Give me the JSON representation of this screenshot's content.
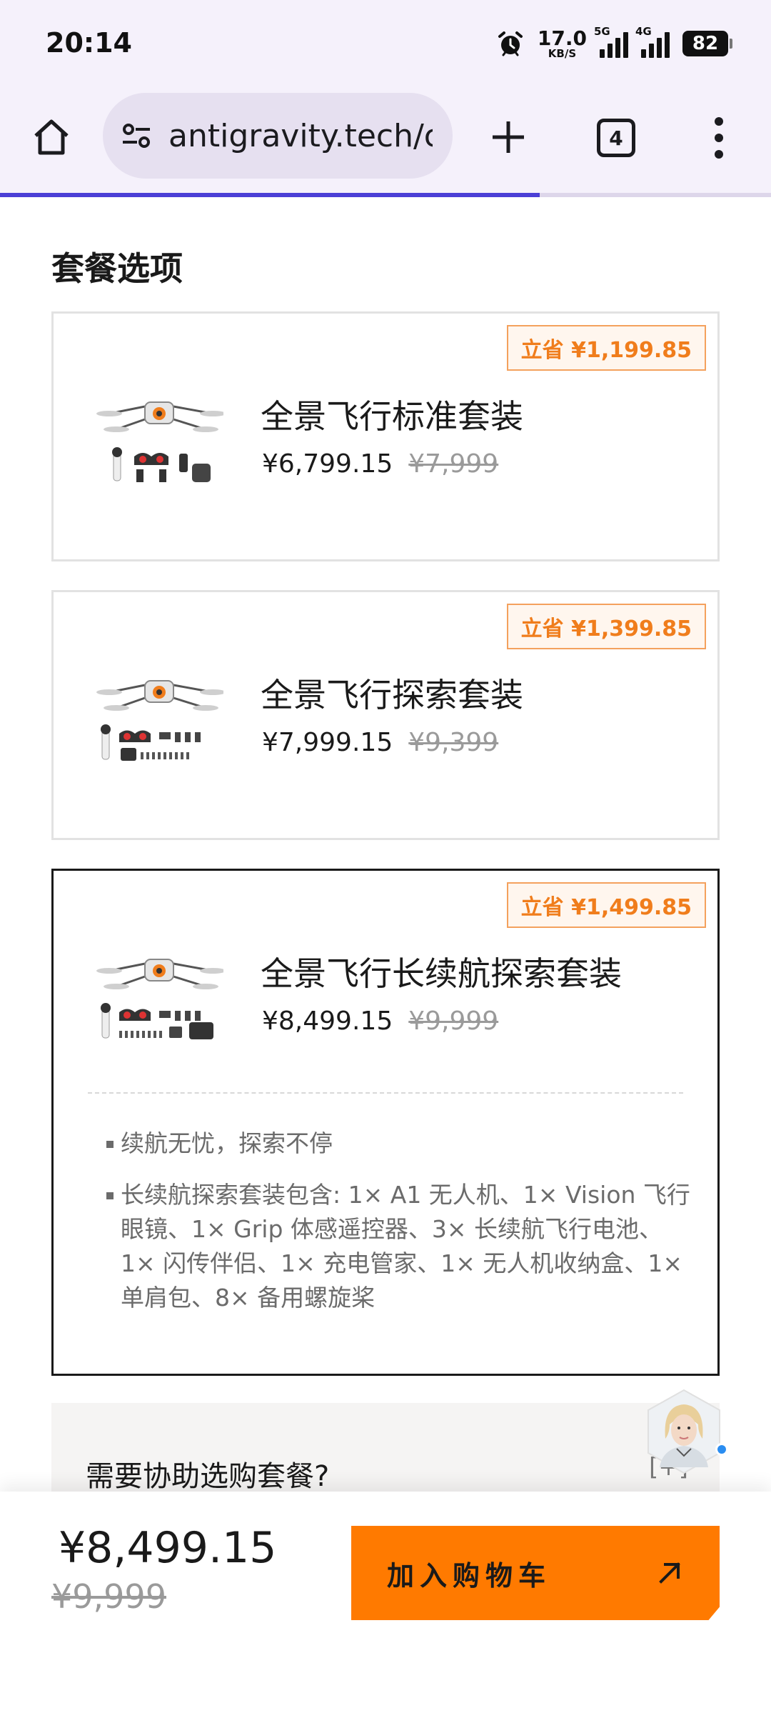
{
  "status_bar": {
    "time": "20:14",
    "net_speed": "17.0",
    "net_unit": "KB/S",
    "sim1_tag": "5G",
    "sim2_tag": "4G",
    "battery": "82",
    "icons": [
      "alarm-icon",
      "signal-icon",
      "battery-icon"
    ]
  },
  "browser": {
    "url": "antigravity.tech/c",
    "tab_count": "4",
    "page_load_progress": 0.7,
    "icons": [
      "home-icon",
      "site-settings-icon",
      "plus-icon",
      "tabs-icon",
      "more-vert-icon"
    ]
  },
  "page": {
    "section_title": "套餐选项",
    "packages": [
      {
        "name": "全景飞行标准套装",
        "price": "¥6,799.15",
        "original_price": "¥7,999",
        "save_label": "立省 ¥1,199.85",
        "selected": false
      },
      {
        "name": "全景飞行探索套装",
        "price": "¥7,999.15",
        "original_price": "¥9,399",
        "save_label": "立省 ¥1,399.85",
        "selected": false
      },
      {
        "name": "全景飞行长续航探索套装",
        "price": "¥8,499.15",
        "original_price": "¥9,999",
        "save_label": "立省 ¥1,499.85",
        "selected": true,
        "features": [
          "续航无忧，探索不停",
          "长续航探索套装包含: 1× A1 无人机、1× Vision 飞行眼镜、1× Grip 体感遥控器、3× 长续航飞行电池、1× 闪传伴侣、1× 充电管家、1× 无人机收纳盒、1× 单肩包、8× 备用螺旋桨"
        ]
      }
    ],
    "help": {
      "text": "需要协助选购套餐?",
      "expand_label": "[+]"
    }
  },
  "bottom_bar": {
    "price": "¥8,499.15",
    "original_price": "¥9,999",
    "add_to_cart_label": "加入购物车"
  },
  "colors": {
    "accent_orange": "#ff7a00",
    "badge_text": "#f07d1c",
    "progress": "#4b3fd6",
    "browser_bg": "#f5f1fb"
  }
}
